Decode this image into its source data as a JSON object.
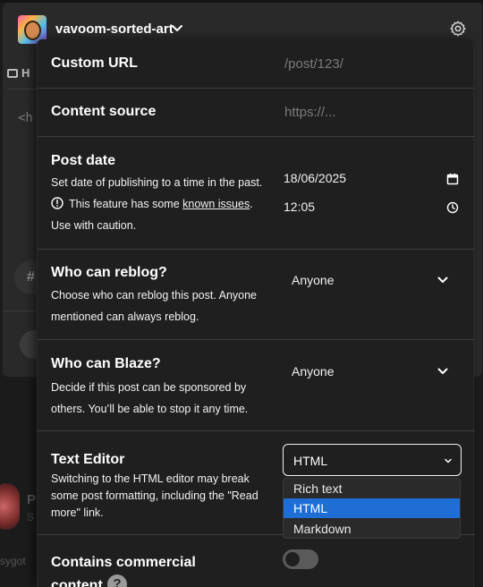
{
  "header": {
    "blog_name": "vavoom-sorted-art"
  },
  "background": {
    "tab_letter": "H",
    "code_snippet": "<h",
    "hash": "#",
    "post_initial": "P",
    "post_sub": "S",
    "footer_fragment": "sygot"
  },
  "settings": {
    "custom_url": {
      "title": "Custom URL",
      "placeholder": "/post/123/"
    },
    "content_source": {
      "title": "Content source",
      "placeholder": "https://..."
    },
    "post_date": {
      "title": "Post date",
      "desc": "Set date of publishing to a time in the past.",
      "warning_prefix": "This feature has some ",
      "warning_link": "known issues",
      "warning_suffix": ". Use with caution.",
      "date": "18/06/2025",
      "time": "12:05"
    },
    "reblog": {
      "title": "Who can reblog?",
      "desc": "Choose who can reblog this post. Anyone mentioned can always reblog.",
      "value": "Anyone"
    },
    "blaze": {
      "title": "Who can Blaze?",
      "desc": "Decide if this post can be sponsored by others. You’ll be able to stop it any time.",
      "value": "Anyone"
    },
    "text_editor": {
      "title": "Text Editor",
      "desc": "Switching to the HTML editor may break some post formatting, including the \"Read more\" link.",
      "selected": "HTML",
      "options": [
        "Rich text",
        "HTML",
        "Markdown"
      ]
    },
    "commercial": {
      "title": "Contains commercial content",
      "help": "?",
      "toggle_on": false
    }
  },
  "colors": {
    "accent_selected": "#1f6ed6",
    "panel_bg": "#1f1f1f"
  }
}
